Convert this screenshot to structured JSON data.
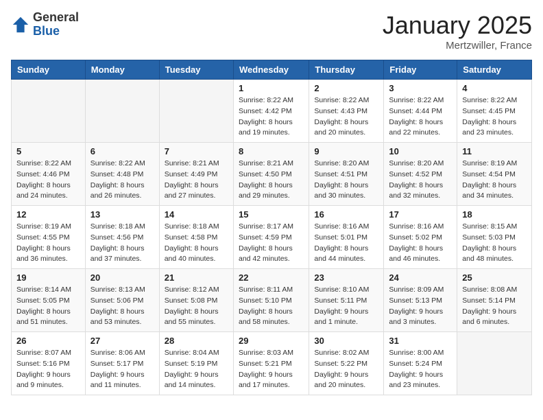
{
  "header": {
    "logo_general": "General",
    "logo_blue": "Blue",
    "month": "January 2025",
    "location": "Mertzwiller, France"
  },
  "weekdays": [
    "Sunday",
    "Monday",
    "Tuesday",
    "Wednesday",
    "Thursday",
    "Friday",
    "Saturday"
  ],
  "weeks": [
    [
      {
        "day": "",
        "info": ""
      },
      {
        "day": "",
        "info": ""
      },
      {
        "day": "",
        "info": ""
      },
      {
        "day": "1",
        "info": "Sunrise: 8:22 AM\nSunset: 4:42 PM\nDaylight: 8 hours\nand 19 minutes."
      },
      {
        "day": "2",
        "info": "Sunrise: 8:22 AM\nSunset: 4:43 PM\nDaylight: 8 hours\nand 20 minutes."
      },
      {
        "day": "3",
        "info": "Sunrise: 8:22 AM\nSunset: 4:44 PM\nDaylight: 8 hours\nand 22 minutes."
      },
      {
        "day": "4",
        "info": "Sunrise: 8:22 AM\nSunset: 4:45 PM\nDaylight: 8 hours\nand 23 minutes."
      }
    ],
    [
      {
        "day": "5",
        "info": "Sunrise: 8:22 AM\nSunset: 4:46 PM\nDaylight: 8 hours\nand 24 minutes."
      },
      {
        "day": "6",
        "info": "Sunrise: 8:22 AM\nSunset: 4:48 PM\nDaylight: 8 hours\nand 26 minutes."
      },
      {
        "day": "7",
        "info": "Sunrise: 8:21 AM\nSunset: 4:49 PM\nDaylight: 8 hours\nand 27 minutes."
      },
      {
        "day": "8",
        "info": "Sunrise: 8:21 AM\nSunset: 4:50 PM\nDaylight: 8 hours\nand 29 minutes."
      },
      {
        "day": "9",
        "info": "Sunrise: 8:20 AM\nSunset: 4:51 PM\nDaylight: 8 hours\nand 30 minutes."
      },
      {
        "day": "10",
        "info": "Sunrise: 8:20 AM\nSunset: 4:52 PM\nDaylight: 8 hours\nand 32 minutes."
      },
      {
        "day": "11",
        "info": "Sunrise: 8:19 AM\nSunset: 4:54 PM\nDaylight: 8 hours\nand 34 minutes."
      }
    ],
    [
      {
        "day": "12",
        "info": "Sunrise: 8:19 AM\nSunset: 4:55 PM\nDaylight: 8 hours\nand 36 minutes."
      },
      {
        "day": "13",
        "info": "Sunrise: 8:18 AM\nSunset: 4:56 PM\nDaylight: 8 hours\nand 37 minutes."
      },
      {
        "day": "14",
        "info": "Sunrise: 8:18 AM\nSunset: 4:58 PM\nDaylight: 8 hours\nand 40 minutes."
      },
      {
        "day": "15",
        "info": "Sunrise: 8:17 AM\nSunset: 4:59 PM\nDaylight: 8 hours\nand 42 minutes."
      },
      {
        "day": "16",
        "info": "Sunrise: 8:16 AM\nSunset: 5:01 PM\nDaylight: 8 hours\nand 44 minutes."
      },
      {
        "day": "17",
        "info": "Sunrise: 8:16 AM\nSunset: 5:02 PM\nDaylight: 8 hours\nand 46 minutes."
      },
      {
        "day": "18",
        "info": "Sunrise: 8:15 AM\nSunset: 5:03 PM\nDaylight: 8 hours\nand 48 minutes."
      }
    ],
    [
      {
        "day": "19",
        "info": "Sunrise: 8:14 AM\nSunset: 5:05 PM\nDaylight: 8 hours\nand 51 minutes."
      },
      {
        "day": "20",
        "info": "Sunrise: 8:13 AM\nSunset: 5:06 PM\nDaylight: 8 hours\nand 53 minutes."
      },
      {
        "day": "21",
        "info": "Sunrise: 8:12 AM\nSunset: 5:08 PM\nDaylight: 8 hours\nand 55 minutes."
      },
      {
        "day": "22",
        "info": "Sunrise: 8:11 AM\nSunset: 5:10 PM\nDaylight: 8 hours\nand 58 minutes."
      },
      {
        "day": "23",
        "info": "Sunrise: 8:10 AM\nSunset: 5:11 PM\nDaylight: 9 hours\nand 1 minute."
      },
      {
        "day": "24",
        "info": "Sunrise: 8:09 AM\nSunset: 5:13 PM\nDaylight: 9 hours\nand 3 minutes."
      },
      {
        "day": "25",
        "info": "Sunrise: 8:08 AM\nSunset: 5:14 PM\nDaylight: 9 hours\nand 6 minutes."
      }
    ],
    [
      {
        "day": "26",
        "info": "Sunrise: 8:07 AM\nSunset: 5:16 PM\nDaylight: 9 hours\nand 9 minutes."
      },
      {
        "day": "27",
        "info": "Sunrise: 8:06 AM\nSunset: 5:17 PM\nDaylight: 9 hours\nand 11 minutes."
      },
      {
        "day": "28",
        "info": "Sunrise: 8:04 AM\nSunset: 5:19 PM\nDaylight: 9 hours\nand 14 minutes."
      },
      {
        "day": "29",
        "info": "Sunrise: 8:03 AM\nSunset: 5:21 PM\nDaylight: 9 hours\nand 17 minutes."
      },
      {
        "day": "30",
        "info": "Sunrise: 8:02 AM\nSunset: 5:22 PM\nDaylight: 9 hours\nand 20 minutes."
      },
      {
        "day": "31",
        "info": "Sunrise: 8:00 AM\nSunset: 5:24 PM\nDaylight: 9 hours\nand 23 minutes."
      },
      {
        "day": "",
        "info": ""
      }
    ]
  ]
}
